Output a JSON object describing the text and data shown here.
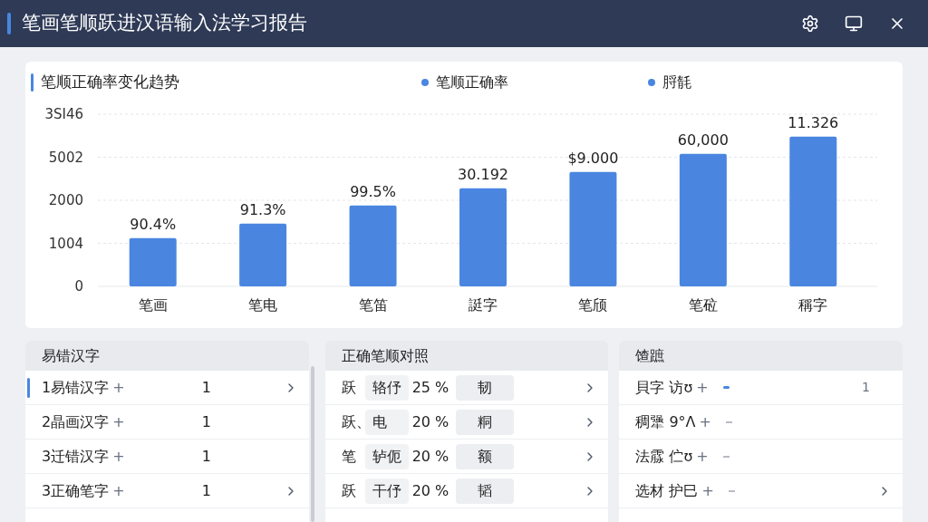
{
  "window": {
    "title": "笔画笔顺跃进汉语输入法学习报告"
  },
  "chart": {
    "title": "笔顺正确率变化趋势",
    "extra_legend": {
      "label": "脟毻",
      "color": "#4a86e0"
    },
    "y_axis_labels": [
      "3SI46",
      "5002",
      "2000",
      "1004",
      "0"
    ],
    "plot": {
      "kind": "bar",
      "grid": true,
      "categories": [
        "笔画",
        "笔电",
        "笔笛",
        "誔字",
        "笔颀",
        "笔砬",
        "稱字"
      ],
      "series": [
        {
          "name": "笔顺正确率",
          "color": "#4a86e0"
        }
      ],
      "value_labels": [
        "90.4%",
        "91.3%",
        "99.5%",
        "30.192",
        "$9.000",
        "60,000",
        "11.326"
      ]
    }
  },
  "panels": [
    {
      "kind": "errors",
      "title": "易错汉字",
      "rows": [
        {
          "label": "1易错汉字",
          "mark": "+",
          "count": "1",
          "selected": true,
          "chevron": true
        },
        {
          "label": "2晶画汉字",
          "mark": "+",
          "count": "1",
          "selected": false,
          "chevron": false
        },
        {
          "label": "3迁错汉字",
          "mark": "+",
          "count": "1",
          "selected": false,
          "chevron": false
        },
        {
          "label": "3正确笔字",
          "mark": "+",
          "count": "1",
          "selected": false,
          "chevron": true
        }
      ]
    },
    {
      "kind": "compare",
      "title": "正确笔顺对照",
      "rows": [
        {
          "char": "跃",
          "strokes": "辂伃",
          "percent": "25 %",
          "target": "韧",
          "chevron": true
        },
        {
          "char": "跃、",
          "strokes": "电",
          "percent": "20 %",
          "target": "粡",
          "chevron": true
        },
        {
          "char": "笔",
          "strokes": "轳伌",
          "percent": "20 %",
          "target": "额",
          "chevron": true
        },
        {
          "char": "跃",
          "strokes": "干伃",
          "percent": "20 %",
          "target": "韬",
          "chevron": true
        }
      ]
    },
    {
      "kind": "notes",
      "title": "馇蹠",
      "rows": [
        {
          "label": "貝字 访ʊ",
          "mark": "+",
          "highlighted": true,
          "count": "1",
          "chevron": false
        },
        {
          "label": "稠犟 9°Λ",
          "mark": "+",
          "highlighted": false,
          "chevron": false
        },
        {
          "label": "法霡 伫ʊ",
          "mark": "+",
          "highlighted": false,
          "chevron": false
        },
        {
          "label": "选材 护巳",
          "mark": "+",
          "highlighted": false,
          "chevron": true
        }
      ]
    }
  ]
}
